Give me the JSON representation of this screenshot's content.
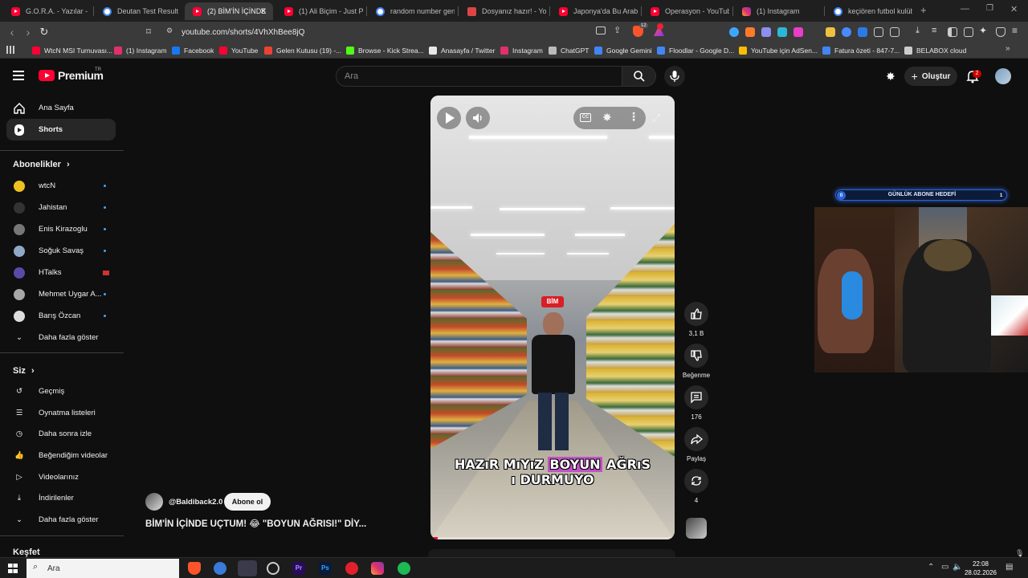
{
  "browser": {
    "tabs": [
      {
        "label": "G.O.R.A. - Yazılar - You",
        "icon": "youtube-icon",
        "active": false
      },
      {
        "label": "Deutan Test Result",
        "icon": "site-icon",
        "active": false
      },
      {
        "label": "(2) BİM'İN İÇİNDE",
        "icon": "youtube-icon",
        "active": true
      },
      {
        "label": "(1) Ali Biçim - Just Pick",
        "icon": "youtube-icon",
        "active": false
      },
      {
        "label": "random number gene",
        "icon": "google-icon",
        "active": false
      },
      {
        "label": "Dosyanız hazır! - YouTu",
        "icon": "site-icon",
        "active": false
      },
      {
        "label": "Japonya'da Bu Arabaya",
        "icon": "youtube-icon",
        "active": false
      },
      {
        "label": "Operasyon - YouTube",
        "icon": "youtube-icon",
        "active": false
      },
      {
        "label": "(1) Instagram",
        "icon": "instagram-icon",
        "active": false
      },
      {
        "label": "keçiören futbol kulübü",
        "icon": "google-icon",
        "active": false
      }
    ],
    "url": "youtube.com/shorts/4VhXhBee8jQ",
    "shield_badge": "12",
    "bookmarks": [
      {
        "label": "WtcN MSI Turnuvası...",
        "color": "#ff0033"
      },
      {
        "label": "(1) Instagram",
        "color": "#e1306c"
      },
      {
        "label": "Facebook",
        "color": "#1877f2"
      },
      {
        "label": "YouTube",
        "color": "#ff0033"
      },
      {
        "label": "Gelen Kutusu (19) -...",
        "color": "#ea4335"
      },
      {
        "label": "Browse - Kick Strea...",
        "color": "#53fc18"
      },
      {
        "label": "Anasayfa / Twitter",
        "color": "#e8e8e8"
      },
      {
        "label": "Instagram",
        "color": "#e1306c"
      },
      {
        "label": "ChatGPT",
        "color": "#bbbbbb"
      },
      {
        "label": "Google Gemini",
        "color": "#4285f4"
      },
      {
        "label": "Floodlar - Google D...",
        "color": "#4285f4"
      },
      {
        "label": "YouTube için AdSen...",
        "color": "#fbbc04"
      },
      {
        "label": "Fatura özeti - 847-7...",
        "color": "#4285f4"
      },
      {
        "label": "BELABOX cloud",
        "color": "#cccccc"
      }
    ]
  },
  "header": {
    "logo": "Premium",
    "logo_region": "TR",
    "search_placeholder": "Ara",
    "create_label": "Oluştur",
    "notification_count": "2"
  },
  "sidebar": {
    "main": [
      {
        "label": "Ana Sayfa",
        "icon": "home-icon"
      },
      {
        "label": "Shorts",
        "icon": "shorts-icon"
      }
    ],
    "subscriptions_title": "Abonelikler",
    "subscriptions": [
      {
        "label": "wtcN",
        "color": "#f0c020"
      },
      {
        "label": "Jahistan",
        "color": "#333333"
      },
      {
        "label": "Enis Kirazoglu",
        "color": "#777777"
      },
      {
        "label": "Soğuk Savaş",
        "color": "#8fa8c8"
      },
      {
        "label": "HTalks",
        "color": "#5a4aa8"
      },
      {
        "label": "Mehmet Uygar A...",
        "color": "#a8a8a8"
      },
      {
        "label": "Barış Özcan",
        "color": "#dddddd"
      }
    ],
    "show_more": "Daha fazla göster",
    "you_title": "Siz",
    "you_items": [
      {
        "label": "Geçmiş",
        "icon": "history-icon"
      },
      {
        "label": "Oynatma listeleri",
        "icon": "playlist-icon"
      },
      {
        "label": "Daha sonra izle",
        "icon": "clock-icon"
      },
      {
        "label": "Beğendiğim videolar",
        "icon": "like-icon"
      },
      {
        "label": "Videolarınız",
        "icon": "video-icon"
      },
      {
        "label": "İndirilenler",
        "icon": "download-icon"
      }
    ],
    "show_more_2": "Daha fazla göster",
    "explore_title": "Keşfet"
  },
  "short": {
    "caption_pre": "HAZıR MıYıZ ",
    "caption_hl": "BOYUN",
    "caption_post": " AĞRıS",
    "caption_line2": "ı DURMUYO",
    "store_sign": "BİM",
    "progress": 0.03,
    "channel": "@Baldiback2.0",
    "subscribe_label": "Abone ol",
    "title": "BİM'İN İÇİNDE UÇTUM! 😂 \"BOYUN AĞRISI!\" DİY..."
  },
  "actions": {
    "like_count": "3,1 B",
    "dislike_label": "Beğenme",
    "comment_count": "176",
    "share_label": "Paylaş",
    "remix_count": "4"
  },
  "overlay": {
    "goal_label": "GÜNLÜK ABONE HEDEFİ",
    "goal_current": "0",
    "goal_target": "1"
  },
  "taskbar": {
    "search_placeholder": "Ara",
    "time": "22:08",
    "date": "28.02.2026"
  }
}
